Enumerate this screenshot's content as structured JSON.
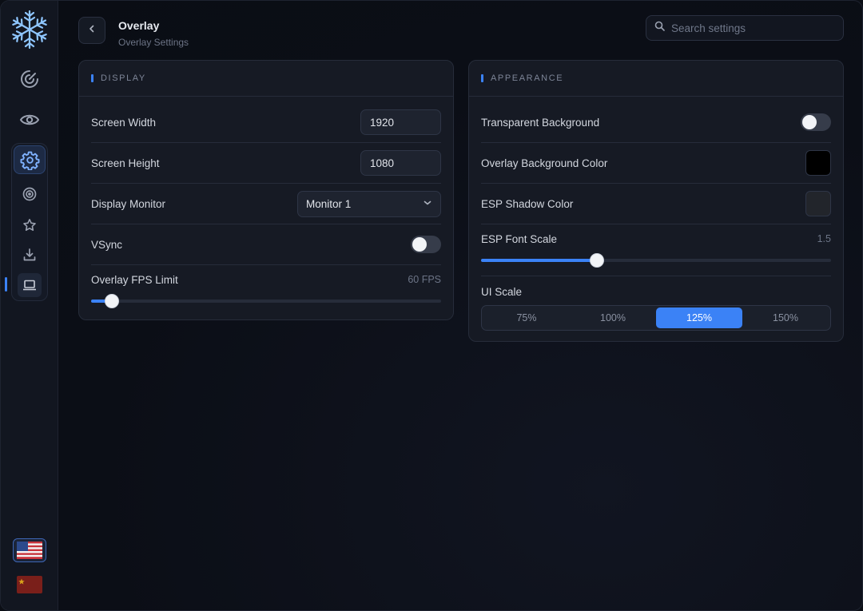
{
  "header": {
    "title": "Overlay",
    "subtitle": "Overlay Settings",
    "search_placeholder": "Search settings"
  },
  "sidebar": {
    "logo": "snowflake-icon",
    "items": [
      {
        "icon": "radar-icon"
      },
      {
        "icon": "eye-icon"
      },
      {
        "icon": "gear-icon",
        "active": true
      },
      {
        "icon": "target-icon"
      },
      {
        "icon": "star-icon"
      },
      {
        "icon": "download-icon"
      },
      {
        "icon": "laptop-icon",
        "current": true
      }
    ],
    "languages": [
      {
        "icon": "us-flag-icon",
        "selected": true
      },
      {
        "icon": "cn-flag-icon"
      }
    ]
  },
  "display": {
    "title": "DISPLAY",
    "screen_width_label": "Screen Width",
    "screen_width_value": "1920",
    "screen_height_label": "Screen Height",
    "screen_height_value": "1080",
    "monitor_label": "Display Monitor",
    "monitor_value": "Monitor 1",
    "vsync_label": "VSync",
    "vsync_on": false,
    "fps_label": "Overlay FPS Limit",
    "fps_value": "60 FPS",
    "fps_fraction": 0.06
  },
  "appearance": {
    "title": "APPEARANCE",
    "transparent_label": "Transparent Background",
    "transparent_on": false,
    "bg_color_label": "Overlay Background Color",
    "bg_color": "#000000",
    "shadow_color_label": "ESP Shadow Color",
    "shadow_color": "#22252b",
    "font_scale_label": "ESP Font Scale",
    "font_scale_value": "1.5",
    "font_scale_fraction": 0.33,
    "ui_scale_label": "UI Scale",
    "ui_scale_options": [
      "75%",
      "100%",
      "125%",
      "150%"
    ],
    "ui_scale_selected": "125%"
  },
  "colors": {
    "accent": "#3b82f6"
  }
}
